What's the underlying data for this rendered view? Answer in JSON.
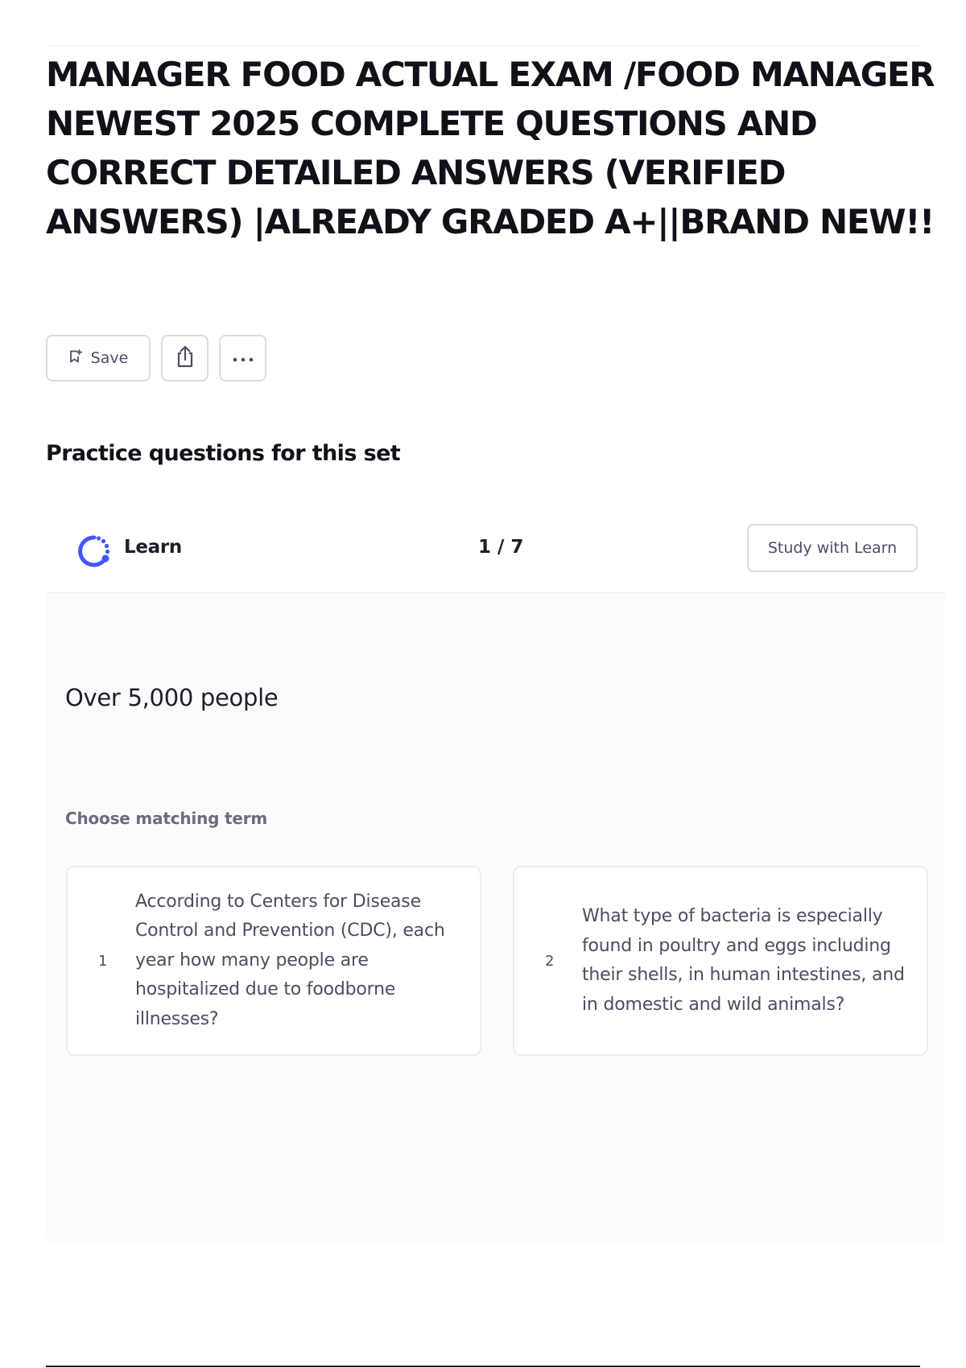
{
  "document": {
    "title": "MANAGER FOOD ACTUAL EXAM  /FOOD MANAGER NEWEST 2025 COMPLETE QUESTIONS AND CORRECT DETAILED ANSWERS (VERIFIED ANSWERS) |ALREADY GRADED A+||BRAND NEW!!"
  },
  "toolbar": {
    "save_label": "Save",
    "save_icon": "bookmark-plus-icon",
    "share_icon": "share-icon",
    "more_icon": "more-icon"
  },
  "practice": {
    "section_title": "Practice questions for this set",
    "mode_label": "Learn",
    "counter": "1 / 7",
    "study_button_label": "Study with Learn",
    "prompt": "Over 5,000 people",
    "instruction": "Choose matching term",
    "options": [
      {
        "number": "1",
        "text": "According to Centers for Disease Control and Prevention (CDC), each year how many people are hospitalized due to foodborne illnesses?"
      },
      {
        "number": "2",
        "text": "What type of bacteria is especially found in poultry and eggs including their shells, in human intestines, and in domestic and wild animals?"
      }
    ]
  },
  "colors": {
    "accent": "#4255ff",
    "text": "#1d1d2b",
    "muted_text": "#4b4d63",
    "border": "#dcdde4"
  }
}
